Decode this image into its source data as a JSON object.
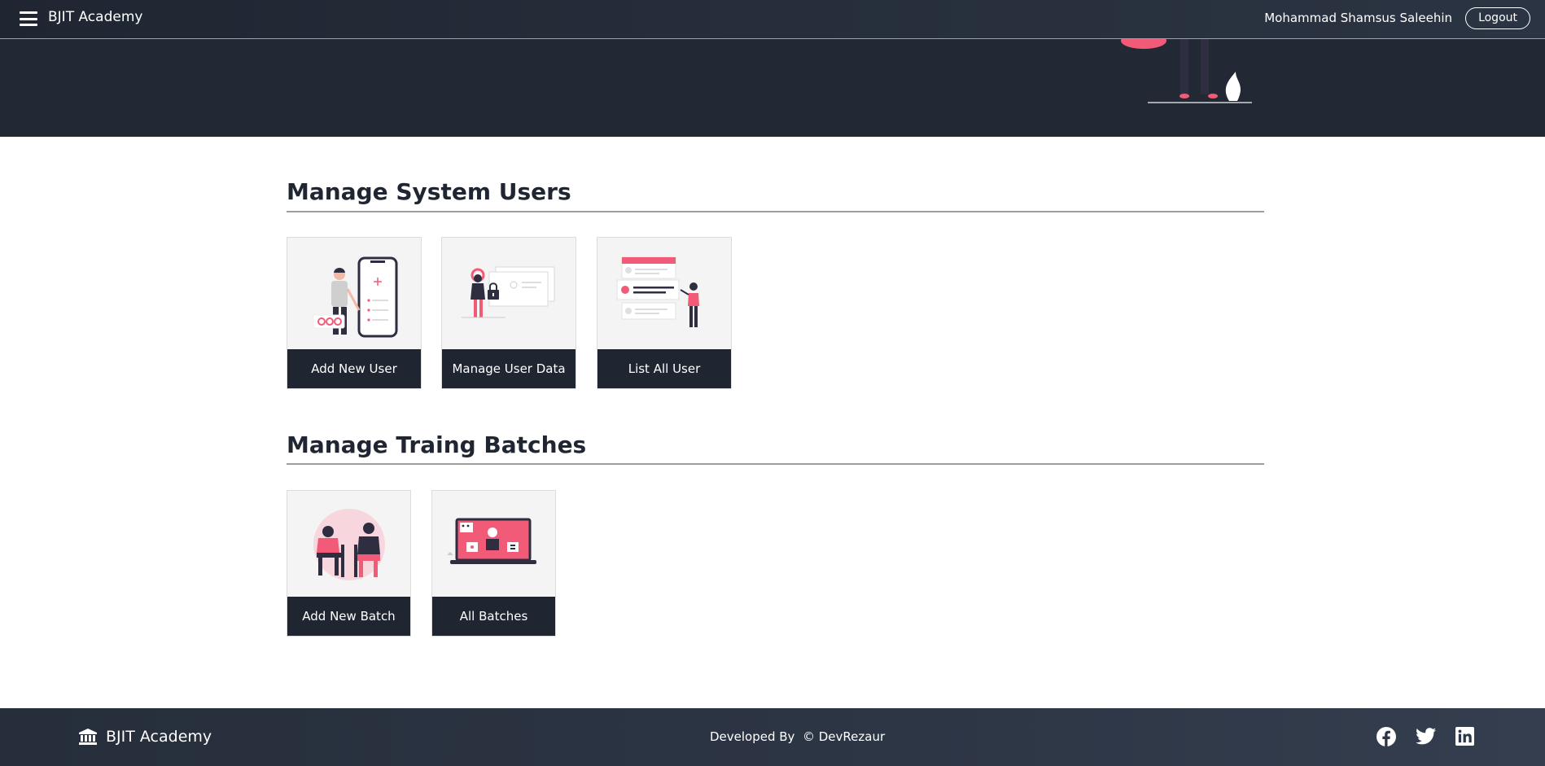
{
  "navbar": {
    "brand": "BJIT Academy",
    "menu_icon": "hamburger-menu-icon",
    "username": "Mohammad Shamsus Saleehin",
    "logout_label": "Logout"
  },
  "sections": [
    {
      "title": "Manage System Users",
      "cards": [
        {
          "label": "Add New User",
          "icon": "add-user-illustration"
        },
        {
          "label": "Manage User Data",
          "icon": "secure-data-illustration"
        },
        {
          "label": "List All User",
          "icon": "user-list-illustration"
        }
      ]
    },
    {
      "title": "Manage Traing Batches",
      "cards": [
        {
          "label": "Add New Batch",
          "icon": "students-illustration"
        },
        {
          "label": "All Batches",
          "icon": "online-class-illustration"
        }
      ]
    }
  ],
  "footer": {
    "brand": "BJIT Academy",
    "brand_icon": "institution-icon",
    "credit": "Developed By  © DevRezaur",
    "social": [
      "facebook-icon",
      "twitter-icon",
      "linkedin-icon"
    ]
  },
  "colors": {
    "dark": "#1f2632",
    "accent": "#f25b77",
    "card_bg": "#f4f4f4"
  }
}
